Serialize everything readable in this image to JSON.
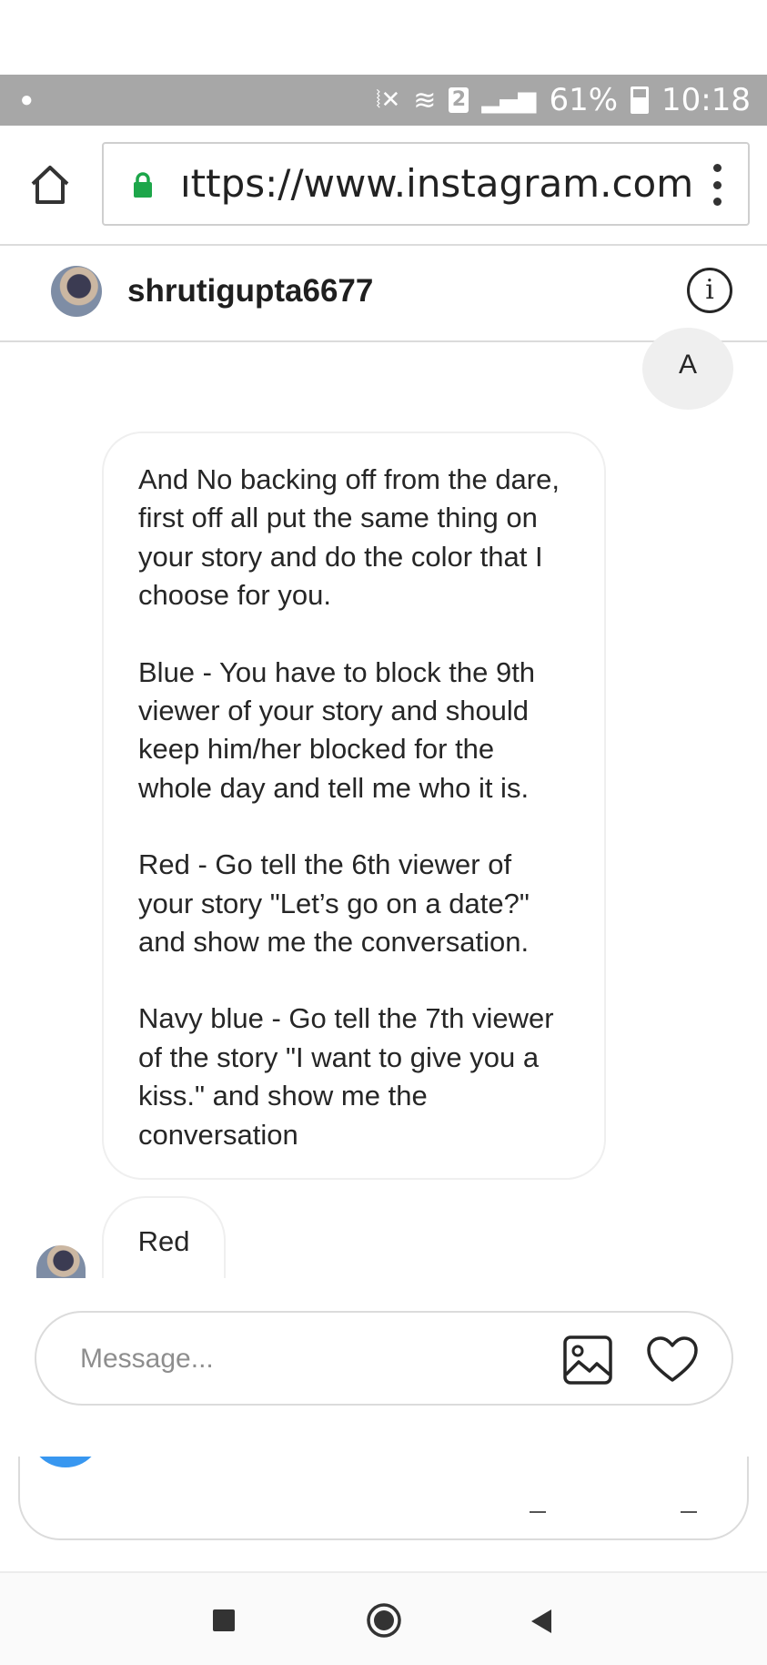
{
  "status_bar": {
    "battery_percent": "61%",
    "sim_slot": "2",
    "time": "10:18"
  },
  "browser": {
    "url": "ıttps://www.instagram.com"
  },
  "thread_header": {
    "username": "shrutigupta6677",
    "info_glyph": "i"
  },
  "messages": {
    "initial_avatar_letter": "A",
    "long_message": {
      "paragraphs": [
        "And No backing off from the dare, first off all put the same thing on your story and do the color that I choose for you.",
        "Blue - You have to block the 9th viewer of your story and should keep him/her blocked for the whole day and tell me who it is.",
        "Red - Go tell the 6th viewer of your story \"Let’s go on a date?\" and show me the conversation.",
        "Navy blue - Go tell the 7th viewer of the story \"I want to give you a kiss.\" and show me the conversation"
      ]
    },
    "reply": "Red"
  },
  "composer": {
    "placeholder": "Message..."
  },
  "icons": {
    "home": "home-icon",
    "lock": "lock-icon",
    "menu": "kebab-menu-icon",
    "info": "info-icon",
    "image": "image-icon",
    "heart": "heart-icon",
    "nav_recent": "square-icon",
    "nav_home": "circle-icon",
    "nav_back": "triangle-back-icon"
  },
  "colors": {
    "status_bar": "#a7a7a7",
    "lock_green": "#1da64a",
    "accent_blue": "#3897f0"
  }
}
